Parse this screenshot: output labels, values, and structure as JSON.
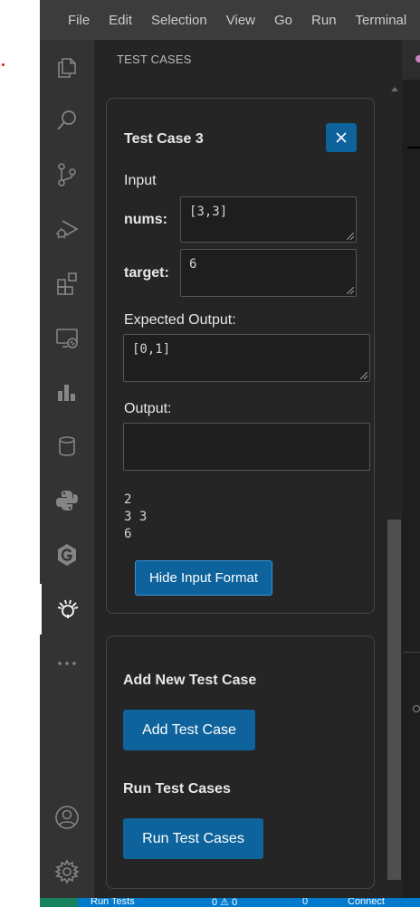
{
  "titlebar": {
    "menu": [
      "File",
      "Edit",
      "Selection",
      "View",
      "Go",
      "Run",
      "Terminal"
    ]
  },
  "activity_bar": {
    "items": [
      {
        "name": "explorer-icon"
      },
      {
        "name": "search-icon"
      },
      {
        "name": "source-control-icon"
      },
      {
        "name": "run-debug-icon"
      },
      {
        "name": "extensions-icon"
      },
      {
        "name": "remote-explorer-icon"
      },
      {
        "name": "chart-icon"
      },
      {
        "name": "database-icon"
      },
      {
        "name": "python-icon"
      },
      {
        "name": "g-extension-icon"
      },
      {
        "name": "test-cases-extension-icon",
        "active": true
      },
      {
        "name": "more-icon"
      }
    ],
    "bottom": [
      {
        "name": "accounts-icon"
      },
      {
        "name": "settings-gear-icon"
      }
    ]
  },
  "sidebar": {
    "title": "TEST CASES",
    "test_case": {
      "title": "Test Case 3",
      "input_label": "Input",
      "fields": [
        {
          "label": "nums:",
          "value": "[3,3]"
        },
        {
          "label": "target:",
          "value": "6"
        }
      ],
      "expected_output_label": "Expected Output:",
      "expected_output_value": "[0,1]",
      "output_label": "Output:",
      "output_value": "",
      "input_format_lines": [
        "2",
        "3 3",
        "6"
      ],
      "hide_input_format_label": "Hide Input Format"
    },
    "add_section": {
      "heading": "Add New Test Case",
      "button_label": "Add Test Case"
    },
    "run_section": {
      "heading": "Run Test Cases",
      "button_label": "Run Test Cases"
    }
  },
  "statusbar": {
    "items": [
      "Run Tests",
      "0 ⚠ 0",
      "0",
      "Connect"
    ]
  },
  "colors": {
    "accent": "#0e639c",
    "statusbar": "#007acc",
    "activity_bar": "#333333",
    "sidebar": "#252526"
  }
}
